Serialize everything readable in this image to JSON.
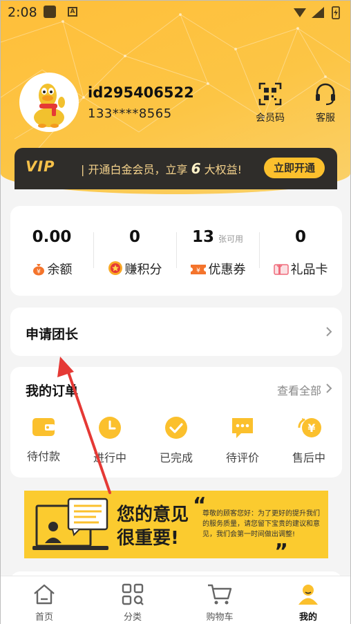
{
  "status_bar": {
    "time": "2:08"
  },
  "profile": {
    "user_id": "id295406522",
    "phone": "133****8565"
  },
  "header_actions": {
    "member_code": "会员码",
    "customer_service": "客服"
  },
  "vip_banner": {
    "logo": "VIP",
    "text_prefix": "| 开通白金会员，立享",
    "number": "6",
    "text_suffix": "大权益!",
    "button": "立即开通"
  },
  "stats": [
    {
      "value": "0.00",
      "sub": "",
      "label": "余额",
      "icon": "money-bag-icon"
    },
    {
      "value": "0",
      "sub": "",
      "label": "赚积分",
      "icon": "points-medal-icon"
    },
    {
      "value": "13",
      "sub": "张可用",
      "label": "优惠券",
      "icon": "coupon-icon"
    },
    {
      "value": "0",
      "sub": "",
      "label": "礼品卡",
      "icon": "gift-card-icon"
    }
  ],
  "apply_leader": {
    "label": "申请团长"
  },
  "orders": {
    "title": "我的订单",
    "view_all": "查看全部",
    "items": [
      {
        "label": "待付款",
        "icon": "wallet-icon"
      },
      {
        "label": "进行中",
        "icon": "clock-icon"
      },
      {
        "label": "已完成",
        "icon": "check-circle-icon"
      },
      {
        "label": "待评价",
        "icon": "comment-icon"
      },
      {
        "label": "售后中",
        "icon": "refund-icon"
      }
    ]
  },
  "feedback_banner": {
    "title_line1": "您的意见",
    "title_line2": "很重要!",
    "text": "尊敬的顾客您好：为了更好的提升我们的服务质量，请您留下宝贵的建议和意见，我们会第一时间做出调整!"
  },
  "tabbar": [
    {
      "label": "首页",
      "icon": "home-icon",
      "active": false
    },
    {
      "label": "分类",
      "icon": "category-grid-icon",
      "active": false
    },
    {
      "label": "购物车",
      "icon": "cart-icon",
      "active": false
    },
    {
      "label": "我的",
      "icon": "profile-icon",
      "active": true
    }
  ],
  "colors": {
    "brand_yellow": "#fbc02d",
    "vip_dark": "#2f2d2a",
    "coupon_orange": "#f4742c",
    "annotation_red": "#e53935"
  }
}
